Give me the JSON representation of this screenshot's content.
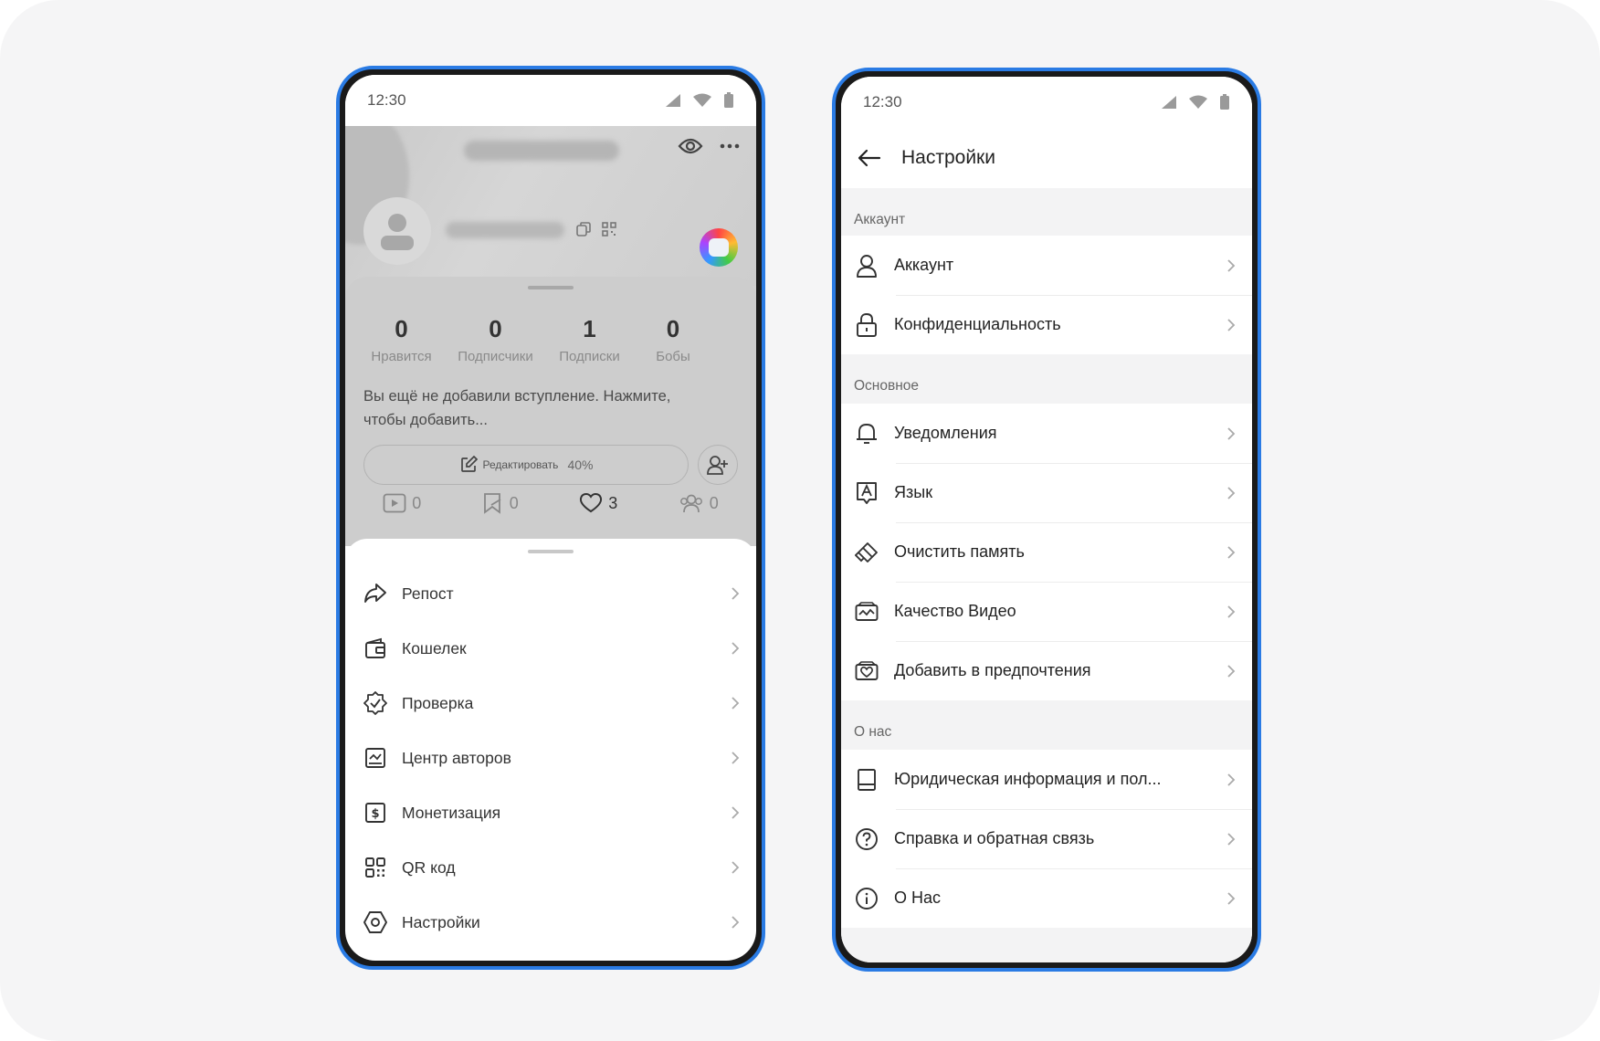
{
  "left_phone": {
    "status": {
      "time": "12:30"
    },
    "stats": [
      {
        "value": "0",
        "label": "Нравится"
      },
      {
        "value": "0",
        "label": "Подписчики"
      },
      {
        "value": "1",
        "label": "Подписки"
      },
      {
        "value": "0",
        "label": "Бобы"
      }
    ],
    "bio_text": "Вы ещё не добавили вступление. Нажмите, чтобы добавить...",
    "edit_button": {
      "label": "Редактировать",
      "percent": "40%"
    },
    "content_tabs": [
      {
        "icon": "video-icon",
        "count": "0"
      },
      {
        "icon": "bookmark-icon",
        "count": "0"
      },
      {
        "icon": "heart-icon",
        "count": "3"
      },
      {
        "icon": "group-icon",
        "count": "0"
      }
    ],
    "menu": [
      {
        "icon": "repost-icon",
        "label": "Репост"
      },
      {
        "icon": "wallet-icon",
        "label": "Кошелек"
      },
      {
        "icon": "verify-icon",
        "label": "Проверка"
      },
      {
        "icon": "creator-center-icon",
        "label": "Центр авторов"
      },
      {
        "icon": "monetization-icon",
        "label": "Монетизация"
      },
      {
        "icon": "qr-code-icon",
        "label": "QR код"
      },
      {
        "icon": "settings-icon",
        "label": "Настройки"
      }
    ]
  },
  "right_phone": {
    "status": {
      "time": "12:30"
    },
    "header_title": "Настройки",
    "sections": [
      {
        "title": "Аккаунт",
        "items": [
          {
            "icon": "user-icon",
            "label": "Аккаунт"
          },
          {
            "icon": "lock-icon",
            "label": "Конфиденциальность"
          }
        ]
      },
      {
        "title": "Основное",
        "items": [
          {
            "icon": "bell-icon",
            "label": "Уведомления"
          },
          {
            "icon": "language-icon",
            "label": "Язык"
          },
          {
            "icon": "eraser-icon",
            "label": "Очистить память"
          },
          {
            "icon": "video-quality-icon",
            "label": "Качество Видео"
          },
          {
            "icon": "preferences-icon",
            "label": "Добавить в предпочтения"
          }
        ]
      },
      {
        "title": "О нас",
        "items": [
          {
            "icon": "document-icon",
            "label": "Юридическая информация и пол..."
          },
          {
            "icon": "help-icon",
            "label": "Справка и обратная связь"
          },
          {
            "icon": "info-icon",
            "label": "О Нас"
          }
        ]
      }
    ]
  },
  "colors": {
    "frame": "#2a7be4",
    "text": "#222222",
    "muted": "#8a8a8a"
  }
}
